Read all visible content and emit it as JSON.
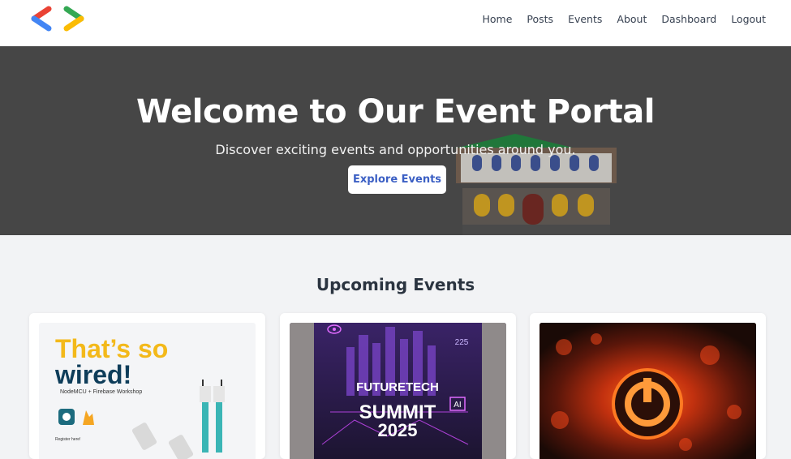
{
  "nav": {
    "items": [
      {
        "label": "Home"
      },
      {
        "label": "Posts"
      },
      {
        "label": "Events"
      },
      {
        "label": "About"
      },
      {
        "label": "Dashboard"
      },
      {
        "label": "Logout"
      }
    ]
  },
  "hero": {
    "title": "Welcome to Our Event Portal",
    "subtitle": "Discover exciting events and opportunities around you.",
    "button": "Explore Events"
  },
  "events": {
    "title": "Upcoming Events",
    "cards": [
      {
        "line1": "That’s so",
        "line2": "wired!",
        "sub": "NodeMCU + Firebase Workshop",
        "register": "Register here!"
      },
      {
        "line1": "FUTURETECH",
        "line2": "SUMMIT",
        "line3": "2025",
        "badge": "AI",
        "corner": "225"
      },
      {}
    ]
  },
  "colors": {
    "hero_bg": "#464646",
    "button_text": "#3b5fc4",
    "page_bg": "#f2f3f5",
    "accent_yellow": "#f3b91a",
    "accent_navy": "#0e3d5a"
  }
}
